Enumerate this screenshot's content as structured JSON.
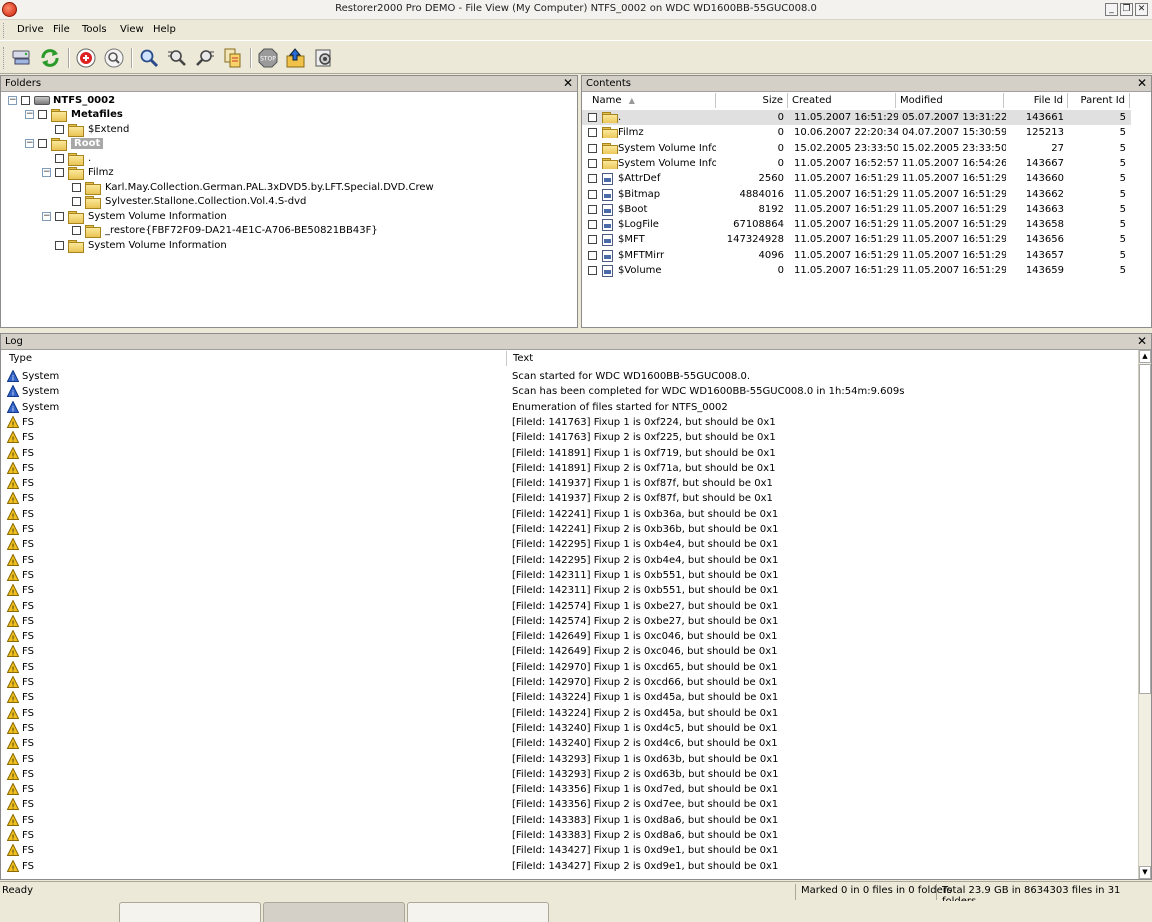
{
  "window": {
    "title": "Restorer2000 Pro DEMO - File View (My Computer) NTFS_0002 on WDC WD1600BB-55GUC008.0",
    "controls": [
      "_",
      "❐",
      "✕"
    ]
  },
  "menu": [
    "Drive",
    "File",
    "Tools",
    "View",
    "Help"
  ],
  "toolbar": {
    "icons": [
      "drive-icon",
      "refresh-icon",
      "mark-icon",
      "unmark-icon",
      "find-icon",
      "find-next-icon",
      "find-prev-icon",
      "copy-icon",
      "stop-icon",
      "export-icon",
      "properties-icon"
    ]
  },
  "folders": {
    "title": "Folders",
    "close": "✕",
    "tree": [
      {
        "label": "NTFS_0002",
        "level": 0,
        "bold": true,
        "icon": "drive",
        "expand": "-",
        "selected": false
      },
      {
        "label": "Metafiles",
        "level": 1,
        "bold": true,
        "icon": "folder",
        "expand": "-",
        "selected": false
      },
      {
        "label": "$Extend",
        "level": 2,
        "bold": false,
        "icon": "folder",
        "expand": "",
        "selected": false
      },
      {
        "label": "Root",
        "level": 1,
        "bold": true,
        "icon": "folder",
        "expand": "-",
        "selected": true
      },
      {
        "label": ".",
        "level": 2,
        "bold": false,
        "icon": "folder",
        "expand": "",
        "selected": false
      },
      {
        "label": "Filmz",
        "level": 2,
        "bold": false,
        "icon": "folder",
        "expand": "-",
        "selected": false
      },
      {
        "label": "Karl.May.Collection.German.PAL.3xDVD5.by.LFT.Special.DVD.Crew",
        "level": 3,
        "bold": false,
        "icon": "folder",
        "expand": "",
        "selected": false
      },
      {
        "label": "Sylvester.Stallone.Collection.Vol.4.S-dvd",
        "level": 3,
        "bold": false,
        "icon": "folder",
        "expand": "",
        "selected": false
      },
      {
        "label": "System Volume Information",
        "level": 2,
        "bold": false,
        "icon": "folder",
        "expand": "-",
        "selected": false
      },
      {
        "label": "_restore{FBF72F09-DA21-4E1C-A706-BE50821BB43F}",
        "level": 3,
        "bold": false,
        "icon": "folder",
        "expand": "",
        "selected": false
      },
      {
        "label": "System Volume Information",
        "level": 2,
        "bold": false,
        "icon": "folder",
        "expand": "",
        "selected": false
      }
    ]
  },
  "contents": {
    "title": "Contents",
    "close": "✕",
    "columns": [
      "Name",
      "Size",
      "Created",
      "Modified",
      "File Id",
      "Parent Id"
    ],
    "rows": [
      {
        "name": ".",
        "size": "0",
        "created": "11.05.2007 16:51:29",
        "modified": "05.07.2007 13:31:22",
        "fileid": "143661",
        "parentid": "5",
        "type": "folder"
      },
      {
        "name": "Filmz",
        "size": "0",
        "created": "10.06.2007 22:20:34",
        "modified": "04.07.2007 15:30:59",
        "fileid": "125213",
        "parentid": "5",
        "type": "folder"
      },
      {
        "name": "System Volume Info...",
        "size": "0",
        "created": "15.02.2005 23:33:50",
        "modified": "15.02.2005 23:33:50",
        "fileid": "27",
        "parentid": "5",
        "type": "folder"
      },
      {
        "name": "System Volume Info...",
        "size": "0",
        "created": "11.05.2007 16:52:57",
        "modified": "11.05.2007 16:54:26",
        "fileid": "143667",
        "parentid": "5",
        "type": "folder"
      },
      {
        "name": "$AttrDef",
        "size": "2560",
        "created": "11.05.2007 16:51:29",
        "modified": "11.05.2007 16:51:29",
        "fileid": "143660",
        "parentid": "5",
        "type": "file"
      },
      {
        "name": "$Bitmap",
        "size": "4884016",
        "created": "11.05.2007 16:51:29",
        "modified": "11.05.2007 16:51:29",
        "fileid": "143662",
        "parentid": "5",
        "type": "file"
      },
      {
        "name": "$Boot",
        "size": "8192",
        "created": "11.05.2007 16:51:29",
        "modified": "11.05.2007 16:51:29",
        "fileid": "143663",
        "parentid": "5",
        "type": "file"
      },
      {
        "name": "$LogFile",
        "size": "67108864",
        "created": "11.05.2007 16:51:29",
        "modified": "11.05.2007 16:51:29",
        "fileid": "143658",
        "parentid": "5",
        "type": "file"
      },
      {
        "name": "$MFT",
        "size": "147324928",
        "created": "11.05.2007 16:51:29",
        "modified": "11.05.2007 16:51:29",
        "fileid": "143656",
        "parentid": "5",
        "type": "file"
      },
      {
        "name": "$MFTMirr",
        "size": "4096",
        "created": "11.05.2007 16:51:29",
        "modified": "11.05.2007 16:51:29",
        "fileid": "143657",
        "parentid": "5",
        "type": "file"
      },
      {
        "name": "$Volume",
        "size": "0",
        "created": "11.05.2007 16:51:29",
        "modified": "11.05.2007 16:51:29",
        "fileid": "143659",
        "parentid": "5",
        "type": "file"
      }
    ]
  },
  "log": {
    "title": "Log",
    "close": "✕",
    "columns": [
      "Type",
      "Text"
    ],
    "rows": [
      {
        "type": "System",
        "kind": "info",
        "text": "Scan started for WDC WD1600BB-55GUC008.0."
      },
      {
        "type": "System",
        "kind": "info",
        "text": "Scan has been completed for WDC WD1600BB-55GUC008.0 in 1h:54m:9.609s"
      },
      {
        "type": "System",
        "kind": "info",
        "text": "Enumeration of files started for NTFS_0002"
      },
      {
        "type": "FS",
        "kind": "warn",
        "text": "[FileId: 141763] Fixup 1 is 0xf224, but should be 0x1"
      },
      {
        "type": "FS",
        "kind": "warn",
        "text": "[FileId: 141763] Fixup 2 is 0xf225, but should be 0x1"
      },
      {
        "type": "FS",
        "kind": "warn",
        "text": "[FileId: 141891] Fixup 1 is 0xf719, but should be 0x1"
      },
      {
        "type": "FS",
        "kind": "warn",
        "text": "[FileId: 141891] Fixup 2 is 0xf71a, but should be 0x1"
      },
      {
        "type": "FS",
        "kind": "warn",
        "text": "[FileId: 141937] Fixup 1 is 0xf87f, but should be 0x1"
      },
      {
        "type": "FS",
        "kind": "warn",
        "text": "[FileId: 141937] Fixup 2 is 0xf87f, but should be 0x1"
      },
      {
        "type": "FS",
        "kind": "warn",
        "text": "[FileId: 142241] Fixup 1 is 0xb36a, but should be 0x1"
      },
      {
        "type": "FS",
        "kind": "warn",
        "text": "[FileId: 142241] Fixup 2 is 0xb36b, but should be 0x1"
      },
      {
        "type": "FS",
        "kind": "warn",
        "text": "[FileId: 142295] Fixup 1 is 0xb4e4, but should be 0x1"
      },
      {
        "type": "FS",
        "kind": "warn",
        "text": "[FileId: 142295] Fixup 2 is 0xb4e4, but should be 0x1"
      },
      {
        "type": "FS",
        "kind": "warn",
        "text": "[FileId: 142311] Fixup 1 is 0xb551, but should be 0x1"
      },
      {
        "type": "FS",
        "kind": "warn",
        "text": "[FileId: 142311] Fixup 2 is 0xb551, but should be 0x1"
      },
      {
        "type": "FS",
        "kind": "warn",
        "text": "[FileId: 142574] Fixup 1 is 0xbe27, but should be 0x1"
      },
      {
        "type": "FS",
        "kind": "warn",
        "text": "[FileId: 142574] Fixup 2 is 0xbe27, but should be 0x1"
      },
      {
        "type": "FS",
        "kind": "warn",
        "text": "[FileId: 142649] Fixup 1 is 0xc046, but should be 0x1"
      },
      {
        "type": "FS",
        "kind": "warn",
        "text": "[FileId: 142649] Fixup 2 is 0xc046, but should be 0x1"
      },
      {
        "type": "FS",
        "kind": "warn",
        "text": "[FileId: 142970] Fixup 1 is 0xcd65, but should be 0x1"
      },
      {
        "type": "FS",
        "kind": "warn",
        "text": "[FileId: 142970] Fixup 2 is 0xcd66, but should be 0x1"
      },
      {
        "type": "FS",
        "kind": "warn",
        "text": "[FileId: 143224] Fixup 1 is 0xd45a, but should be 0x1"
      },
      {
        "type": "FS",
        "kind": "warn",
        "text": "[FileId: 143224] Fixup 2 is 0xd45a, but should be 0x1"
      },
      {
        "type": "FS",
        "kind": "warn",
        "text": "[FileId: 143240] Fixup 1 is 0xd4c5, but should be 0x1"
      },
      {
        "type": "FS",
        "kind": "warn",
        "text": "[FileId: 143240] Fixup 2 is 0xd4c6, but should be 0x1"
      },
      {
        "type": "FS",
        "kind": "warn",
        "text": "[FileId: 143293] Fixup 1 is 0xd63b, but should be 0x1"
      },
      {
        "type": "FS",
        "kind": "warn",
        "text": "[FileId: 143293] Fixup 2 is 0xd63b, but should be 0x1"
      },
      {
        "type": "FS",
        "kind": "warn",
        "text": "[FileId: 143356] Fixup 1 is 0xd7ed, but should be 0x1"
      },
      {
        "type": "FS",
        "kind": "warn",
        "text": "[FileId: 143356] Fixup 2 is 0xd7ee, but should be 0x1"
      },
      {
        "type": "FS",
        "kind": "warn",
        "text": "[FileId: 143383] Fixup 1 is 0xd8a6, but should be 0x1"
      },
      {
        "type": "FS",
        "kind": "warn",
        "text": "[FileId: 143383] Fixup 2 is 0xd8a6, but should be 0x1"
      },
      {
        "type": "FS",
        "kind": "warn",
        "text": "[FileId: 143427] Fixup 1 is 0xd9e1, but should be 0x1"
      },
      {
        "type": "FS",
        "kind": "warn",
        "text": "[FileId: 143427] Fixup 2 is 0xd9e1, but should be 0x1"
      }
    ]
  },
  "status": {
    "ready": "Ready",
    "marked": "Marked 0 in 0 files in 0 folders",
    "total": "Total 23.9 GB in 8634303 files in 31 folders"
  },
  "colors": {
    "selection": "#a8a8a8",
    "info_icon": "#3464c8",
    "warn_icon": "#f0c020"
  }
}
